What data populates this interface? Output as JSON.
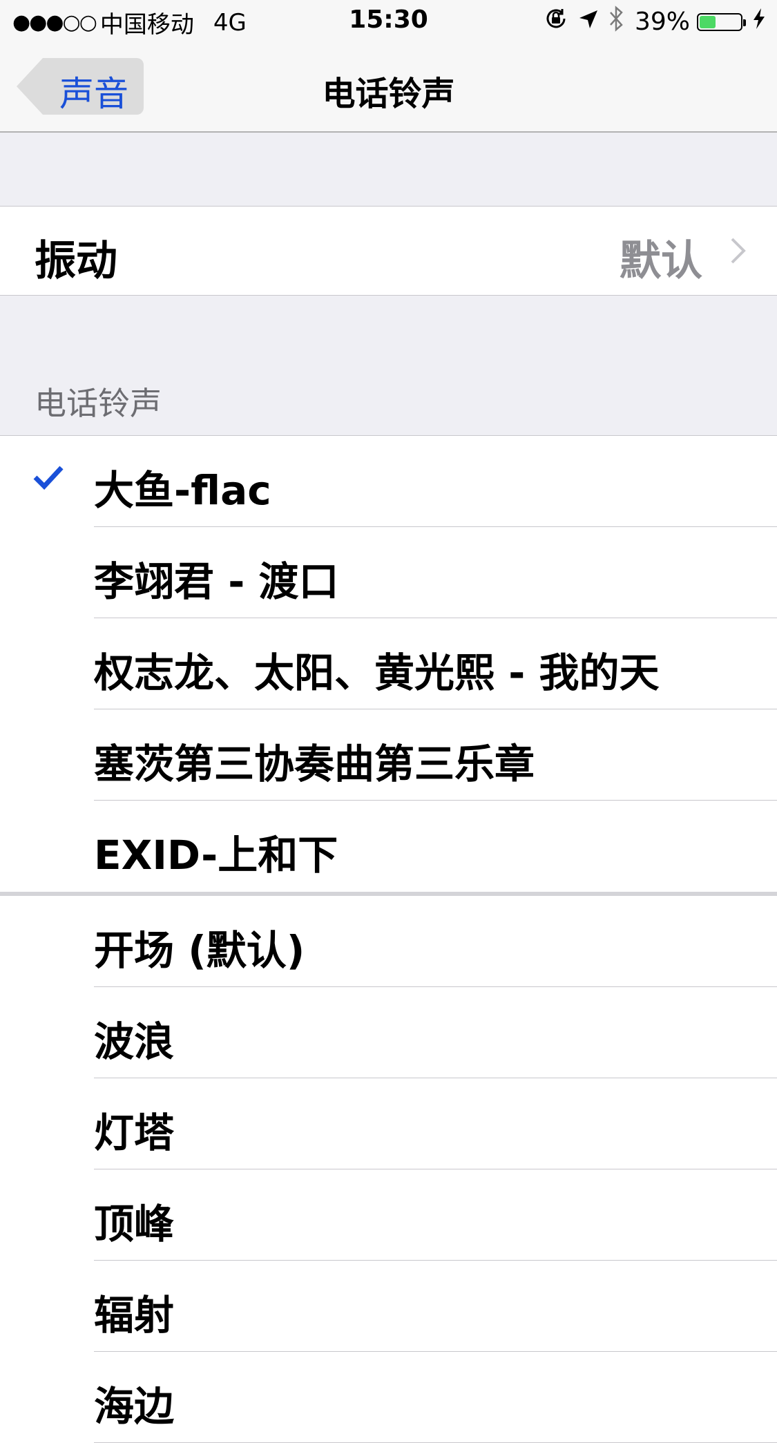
{
  "status_bar": {
    "signal": "●●●○○",
    "carrier": "中国移动",
    "network": "4G",
    "time": "15:30",
    "battery_percent": "39%",
    "battery_level": 0.39,
    "icons": [
      "rotation-lock-icon",
      "location-arrow-icon",
      "bluetooth-icon",
      "charging-bolt-icon"
    ]
  },
  "nav": {
    "back_label": "声音",
    "title": "电话铃声"
  },
  "vibration": {
    "label": "振动",
    "value": "默认"
  },
  "section_header": "电话铃声",
  "custom_ringtones": [
    {
      "label": "大鱼-flac",
      "selected": true
    },
    {
      "label": "李翊君 - 渡口",
      "selected": false
    },
    {
      "label": "权志龙、太阳、黄光熙 - 我的天",
      "selected": false
    },
    {
      "label": "塞茨第三协奏曲第三乐章",
      "selected": false
    },
    {
      "label": "EXID-上和下",
      "selected": false
    }
  ],
  "builtin_ringtones": [
    {
      "label": "开场 (默认)",
      "selected": false
    },
    {
      "label": "波浪",
      "selected": false
    },
    {
      "label": "灯塔",
      "selected": false
    },
    {
      "label": "顶峰",
      "selected": false
    },
    {
      "label": "辐射",
      "selected": false
    },
    {
      "label": "海边",
      "selected": false
    }
  ],
  "colors": {
    "accent": "#1a50d8",
    "battery": "#4cd964",
    "secondary_text": "#8e8e93",
    "background": "#efeff4"
  }
}
